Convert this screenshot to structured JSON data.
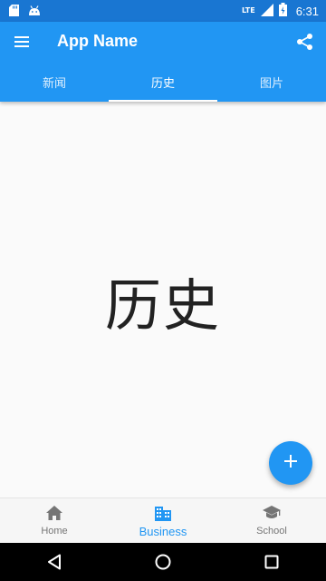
{
  "status_bar": {
    "time": "6:31",
    "network": "LTE",
    "icons": [
      "sd-card-icon",
      "android-icon",
      "signal-icon",
      "battery-icon"
    ]
  },
  "app_bar": {
    "title": "App Name",
    "menu_icon": "hamburger-menu-icon",
    "share_icon": "share-icon",
    "color": "#2196f3"
  },
  "tabs": [
    {
      "label": "新闻",
      "selected": false
    },
    {
      "label": "历史",
      "selected": true
    },
    {
      "label": "图片",
      "selected": false
    }
  ],
  "content": {
    "text": "历史"
  },
  "fab": {
    "icon": "plus-icon"
  },
  "bottom_nav": {
    "items": [
      {
        "label": "Home",
        "icon": "home-icon",
        "selected": false
      },
      {
        "label": "Business",
        "icon": "business-icon",
        "selected": true
      },
      {
        "label": "School",
        "icon": "school-icon",
        "selected": false
      }
    ],
    "active_color": "#2196f3",
    "inactive_color": "#757575"
  },
  "system_nav": {
    "icons": [
      "back-icon",
      "home-circle-icon",
      "recents-icon"
    ]
  }
}
